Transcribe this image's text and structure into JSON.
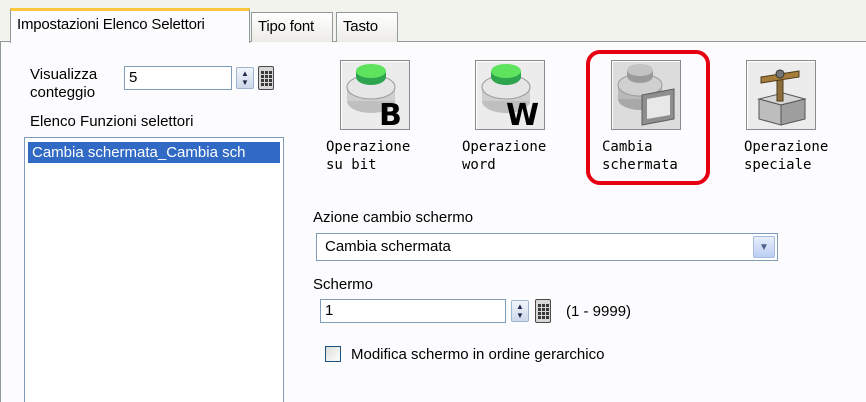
{
  "tabs": [
    {
      "label": "Impostazioni Elenco Selettori",
      "active": true
    },
    {
      "label": "Tipo font",
      "active": false
    },
    {
      "label": "Tasto",
      "active": false
    }
  ],
  "left": {
    "count_label_1": "Visualizza",
    "count_label_2": "conteggio",
    "count_value": "5",
    "list_label": "Elenco Funzioni selettori",
    "list_items": [
      "Cambia schermata_Cambia sch"
    ]
  },
  "operations": [
    {
      "line1": "Operazione",
      "line2": "su bit",
      "icon": "bit-operation-icon",
      "letter": "B"
    },
    {
      "line1": "Operazione",
      "line2": "word",
      "icon": "word-operation-icon",
      "letter": "W"
    },
    {
      "line1": "Cambia",
      "line2": "schermata",
      "icon": "change-screen-icon",
      "selected": true
    },
    {
      "line1": "Operazione",
      "line2": "speciale",
      "icon": "special-operation-icon"
    }
  ],
  "action": {
    "label": "Azione cambio schermo",
    "value": "Cambia schermata"
  },
  "screen": {
    "label": "Schermo",
    "value": "1",
    "range": "(1 - 9999)"
  },
  "hierarchy_checkbox": {
    "label": "Modifica schermo in ordine gerarchico",
    "checked": false
  },
  "colors": {
    "highlight": "#e60012",
    "selection": "#316ac5",
    "active_tab_accent": "#ffc83c"
  }
}
